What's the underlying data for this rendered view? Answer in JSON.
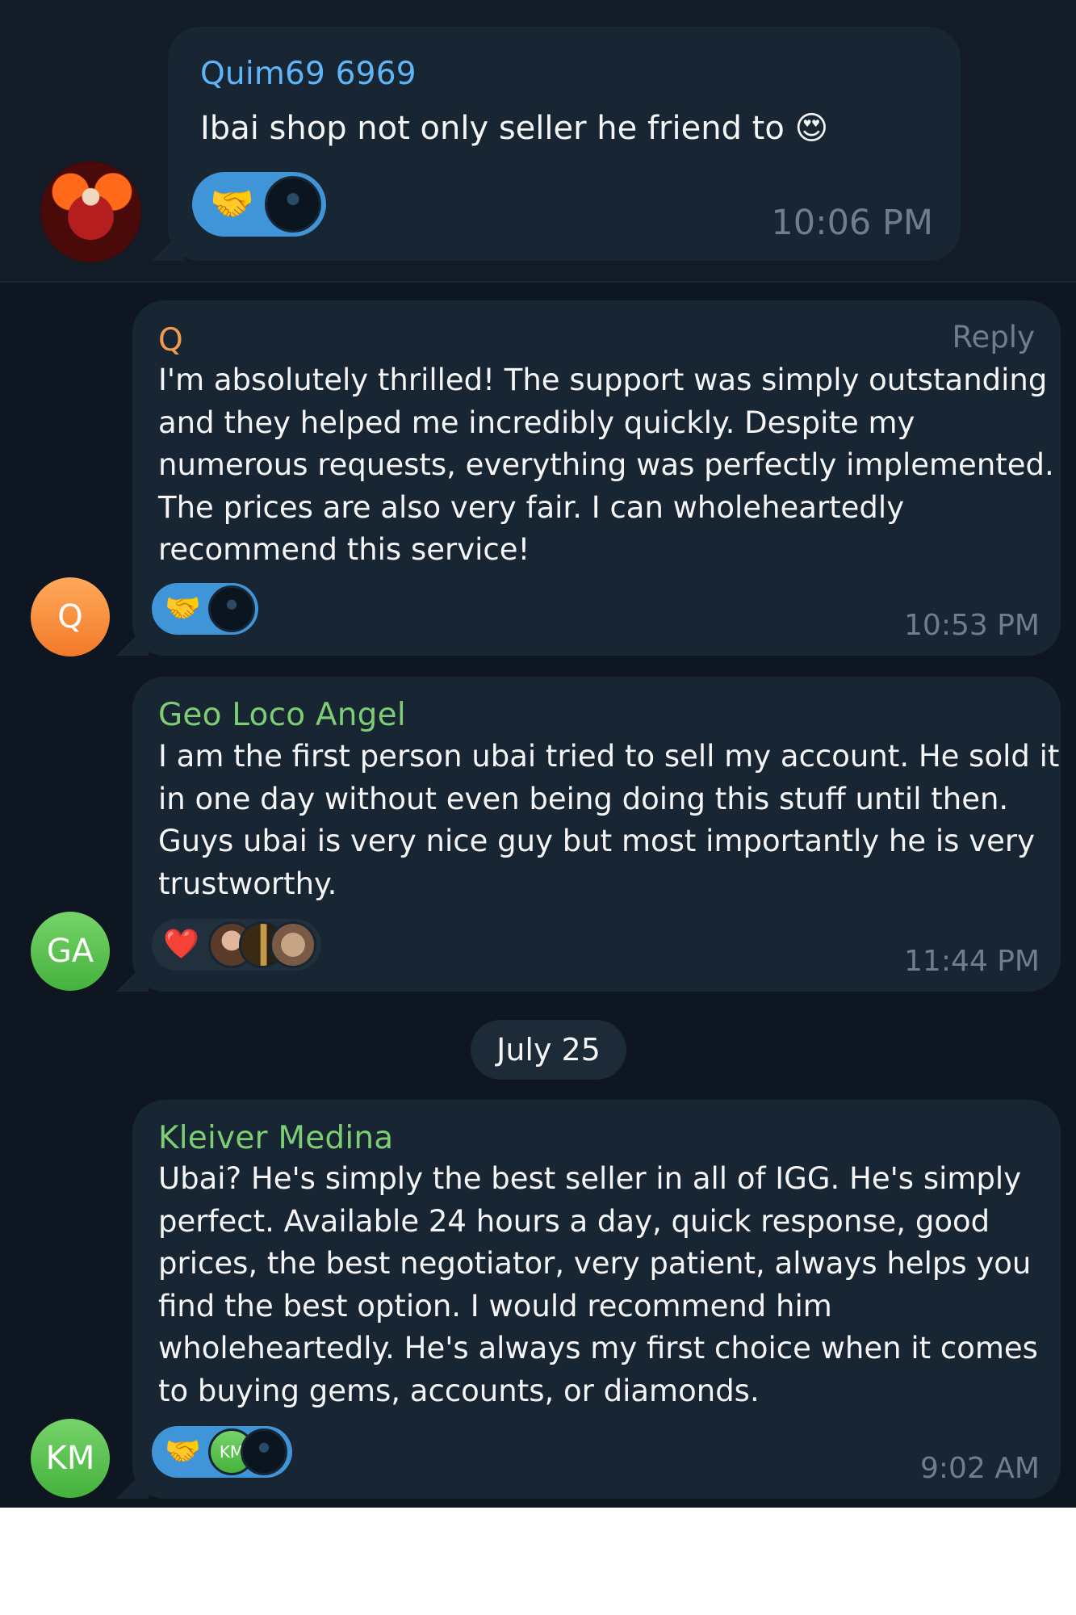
{
  "messages": [
    {
      "sender": "Quim69 6969",
      "text": "Ibai shop not only seller he friend to 😍",
      "time": "10:06 PM",
      "reaction_emoji": "🤝"
    },
    {
      "sender": "Q",
      "avatar_initials": "Q",
      "reply_label": "Reply",
      "text": "I'm absolutely thrilled! The support was simply outstanding\nand they helped me incredibly quickly. Despite my\nnumerous requests, everything was perfectly implemented.\nThe prices are also very fair. I can wholeheartedly\nrecommend this service!",
      "time": "10:53 PM",
      "reaction_emoji": "🤝"
    },
    {
      "sender": "Geo Loco Angel",
      "avatar_initials": "GA",
      "text": "I am the first person ubai tried to sell my account. He sold it\nin one day without even being doing this stuff until then.\nGuys ubai is very nice guy but most importantly he is very\ntrustworthy.",
      "time": "11:44 PM",
      "reaction_emoji": "❤️"
    },
    {
      "sender": "Kleiver Medina",
      "avatar_initials": "KM",
      "text": "Ubai? He's simply the best seller in all of IGG. He's simply\nperfect. Available 24 hours a day, quick response, good\nprices, the best negotiator, very patient, always helps you\nfind the best option. I would recommend him\nwholeheartedly. He's always my first choice when it comes\nto buying gems, accounts, or diamonds.",
      "time": "9:02 AM",
      "reaction_emoji": "🤝",
      "reaction_avatar_initials": "KM"
    }
  ],
  "date_separator": "July 25",
  "colors": {
    "background": "#0e1621",
    "bubble": "#182533",
    "reaction_active": "#3f95d8",
    "sender_blue": "#5eb5f7",
    "sender_orange": "#f29b4c",
    "sender_green": "#7ccd74"
  }
}
